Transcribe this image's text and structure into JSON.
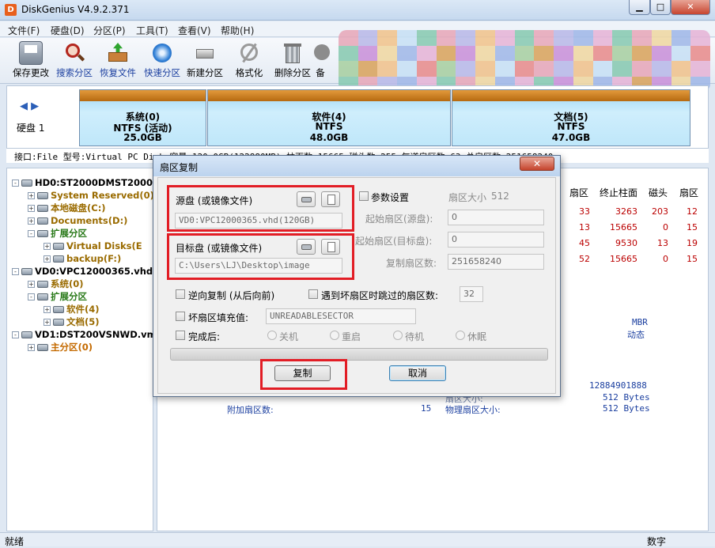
{
  "window": {
    "title": "DiskGenius V4.9.2.371",
    "min": "▁",
    "max": "□",
    "close": "✕"
  },
  "menu": [
    "文件(F)",
    "硬盘(D)",
    "分区(P)",
    "工具(T)",
    "查看(V)",
    "帮助(H)"
  ],
  "toolbar": [
    {
      "label": "保存更改",
      "icon": "save-icon",
      "blue": false
    },
    {
      "label": "搜索分区",
      "icon": "search-partition-icon",
      "blue": true
    },
    {
      "label": "恢复文件",
      "icon": "recover-files-icon",
      "blue": true
    },
    {
      "label": "快速分区",
      "icon": "quick-partition-icon",
      "blue": true
    },
    {
      "label": "新建分区",
      "icon": "new-partition-icon",
      "blue": false
    },
    {
      "label": "格式化",
      "icon": "format-icon",
      "blue": false
    },
    {
      "label": "删除分区",
      "icon": "delete-partition-icon",
      "blue": false
    },
    {
      "label": "备",
      "icon": "backup-icon",
      "blue": false
    }
  ],
  "diskmap": {
    "disk_label": "硬盘 1",
    "partitions": [
      {
        "name": "系统(0)",
        "fs": "NTFS (活动)",
        "size": "25.0GB"
      },
      {
        "name": "软件(4)",
        "fs": "NTFS",
        "size": "48.0GB"
      },
      {
        "name": "文档(5)",
        "fs": "NTFS",
        "size": "47.0GB"
      }
    ]
  },
  "infoline": "接口:File  型号:Virtual PC Disk   容量:120.0GB(122880MB)  柱面数:15665  磁头数:255  每道扇区数:63  总扇区数:251658240",
  "tree": [
    {
      "text": "HD0:ST2000DMST2000DM",
      "level": 0,
      "color": "dark",
      "toggle": "-"
    },
    {
      "text": "System Reserved(0)",
      "level": 1,
      "color": "brown",
      "toggle": "+"
    },
    {
      "text": "本地磁盘(C:)",
      "level": 1,
      "color": "brown",
      "toggle": "+"
    },
    {
      "text": "Documents(D:)",
      "level": 1,
      "color": "brown",
      "toggle": "+"
    },
    {
      "text": "扩展分区",
      "level": 1,
      "color": "green",
      "toggle": "-"
    },
    {
      "text": "Virtual Disks(E",
      "level": 2,
      "color": "brown",
      "toggle": "+"
    },
    {
      "text": "backup(F:)",
      "level": 2,
      "color": "brown",
      "toggle": "+"
    },
    {
      "text": "VD0:VPC12000365.vhd(",
      "level": 0,
      "color": "dark",
      "toggle": "-"
    },
    {
      "text": "系统(0)",
      "level": 1,
      "color": "brown",
      "toggle": "+"
    },
    {
      "text": "扩展分区",
      "level": 1,
      "color": "green",
      "toggle": "-"
    },
    {
      "text": "软件(4)",
      "level": 2,
      "color": "brown",
      "toggle": "+"
    },
    {
      "text": "文档(5)",
      "level": 2,
      "color": "brown",
      "toggle": "+"
    },
    {
      "text": "VD1:DST200VSNWD.vmdk",
      "level": 0,
      "color": "dark",
      "toggle": "-"
    },
    {
      "text": "主分区(0)",
      "level": 1,
      "color": "orange",
      "toggle": "+"
    }
  ],
  "table": {
    "headers": [
      "扇区",
      "终止柱面",
      "磁头",
      "扇区"
    ],
    "rows": [
      [
        "33",
        "3263",
        "203",
        "12"
      ],
      [
        "13",
        "15665",
        "0",
        "15"
      ],
      [
        "45",
        "9530",
        "13",
        "19"
      ],
      [
        "52",
        "15665",
        "0",
        "15"
      ]
    ]
  },
  "details": {
    "mbr": "MBR",
    "dynamic": "动态",
    "total_bytes": "12884901888",
    "sector_size_label": "扇区大小:",
    "sector_size": "512 Bytes",
    "extra_sectors_label": "附加扇区数:",
    "extra_sectors": "15",
    "physical_sector_label": "物理扇区大小:",
    "physical_sector": "512 Bytes",
    "total_sectors_label": "总扇区数:",
    "total_sectors": "251658240"
  },
  "status": {
    "left": "就绪",
    "right": "数字"
  },
  "dialog": {
    "title": "扇区复制",
    "close": "✕",
    "source_label": "源盘 (或镜像文件)",
    "source_value": "VD0:VPC12000365.vhd(120GB)",
    "target_label": "目标盘 (或镜像文件)",
    "target_value": "C:\\Users\\LJ\\Desktop\\image",
    "param_label": "参数设置",
    "sector_size_label": "扇区大小",
    "sector_size_value": "512",
    "start_src_label": "起始扇区(源盘):",
    "start_src_value": "0",
    "start_dst_label": "起始扇区(目标盘):",
    "start_dst_value": "0",
    "copy_count_label": "复制扇区数:",
    "copy_count_value": "251658240",
    "reverse_label": "逆向复制 (从后向前)",
    "skip_bad_label": "遇到坏扇区时跳过的扇区数:",
    "skip_bad_value": "32",
    "fill_bad_label": "坏扇区填充值:",
    "fill_bad_value": "UNREADABLESECTOR",
    "after_label": "完成后:",
    "after_options": [
      "关机",
      "重启",
      "待机",
      "休眠"
    ],
    "copy_button": "复制",
    "cancel_button": "取消"
  },
  "colors": {
    "highlight": "#e21d25",
    "accent_blue": "#1a3e9f",
    "partition_bar": "#c77a1c"
  }
}
